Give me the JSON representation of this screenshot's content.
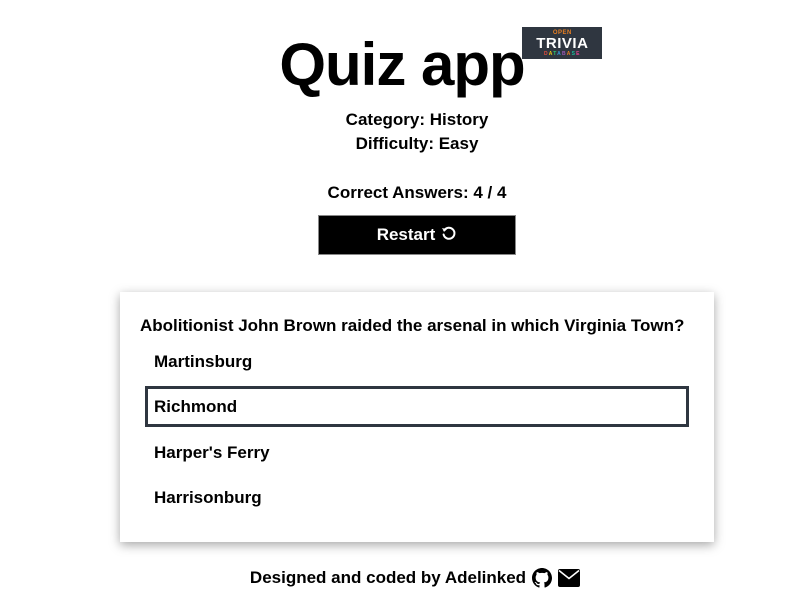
{
  "header": {
    "title": "Quiz app",
    "logo": {
      "open": "OPEN",
      "trivia": "TRIVIA",
      "database": "DATABASE"
    }
  },
  "meta": {
    "category": "Category: History",
    "difficulty": "Difficulty: Easy",
    "score": "Correct Answers: 4 / 4"
  },
  "restart": {
    "label": "Restart",
    "icon": "restart-icon"
  },
  "quiz": {
    "question": "Abolitionist John Brown raided the arsenal in which Virginia Town?",
    "options": [
      "Martinsburg",
      "Richmond",
      "Harper's Ferry",
      "Harrisonburg"
    ],
    "selected_index": 1
  },
  "footer": {
    "text": "Designed and coded by Adelinked",
    "icons": [
      "github-icon",
      "envelope-icon"
    ]
  },
  "colors": {
    "accent": "#2f3640",
    "button": "#000000"
  }
}
